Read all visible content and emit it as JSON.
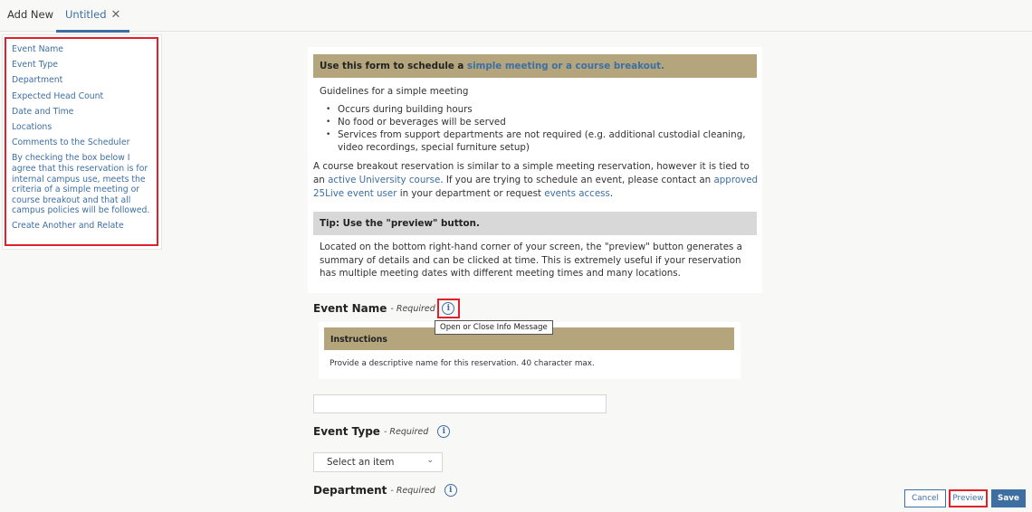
{
  "tabs": {
    "add_new": "Add New",
    "untitled": "Untitled",
    "close_glyph": "✕"
  },
  "sidebar": {
    "items": [
      {
        "label": "Event Name"
      },
      {
        "label": "Event Type"
      },
      {
        "label": "Department"
      },
      {
        "label": "Expected Head Count"
      },
      {
        "label": "Date and Time"
      },
      {
        "label": "Locations"
      },
      {
        "label": "Comments to the Scheduler"
      },
      {
        "label": "By checking the box below I agree that this reservation is for internal campus use, meets the criteria of a simple meeting or course breakout and that all campus policies will be followed."
      },
      {
        "label": "Create Another and Relate"
      }
    ]
  },
  "intro": {
    "banner_prefix": "Use this form to schedule a ",
    "banner_link": "simple meeting or a course breakout.",
    "guidelines_title": "Guidelines for a simple meeting",
    "guidelines": [
      "Occurs during building hours",
      "No food or beverages will be served",
      "Services from support departments are not required (e.g. additional custodial cleaning, video recordings, special furniture setup)"
    ],
    "breakout_1": "A course breakout reservation is similar to a simple meeting reservation, however it is tied to an ",
    "breakout_link_1": "active University course",
    "breakout_2": ". If you are trying to schedule an event, please contact an ",
    "breakout_link_2": "approved 25Live event user",
    "breakout_3": " in your department or request ",
    "breakout_link_3": "events access",
    "breakout_4": ".",
    "tip_title": "Tip: Use the \"preview\" button.",
    "tip_body": "Located on the bottom right-hand corner of your screen, the \"preview\" button generates a summary of details and can be clicked at time. This is extremely useful if your reservation has multiple meeting dates with different meeting times and many locations."
  },
  "fields": {
    "event_name": {
      "label": "Event Name",
      "required": "- Required",
      "tooltip": "Open or Close Info Message",
      "instructions_title": "Instructions",
      "instructions_body": "Provide a descriptive name for this reservation. 40 character max.",
      "value": ""
    },
    "event_type": {
      "label": "Event Type",
      "required": "- Required",
      "selected": "Select an item"
    },
    "department": {
      "label": "Department",
      "required": "- Required"
    }
  },
  "footer": {
    "cancel": "Cancel",
    "preview": "Preview",
    "save": "Save"
  },
  "icons": {
    "info": "i",
    "chevron_down": "⌄"
  }
}
